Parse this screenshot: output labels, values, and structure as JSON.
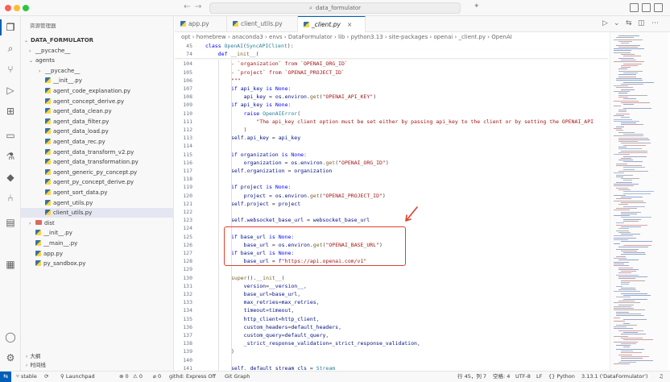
{
  "titlebar": {
    "search_text": "data_formulator"
  },
  "sidebar": {
    "title": "资源管理器",
    "tree": [
      {
        "label": "DATA_FORMULATOR",
        "depth": 0,
        "kind": "root",
        "chev": "⌄"
      },
      {
        "label": "__pycache__",
        "depth": 1,
        "kind": "folder",
        "chev": "›"
      },
      {
        "label": "agents",
        "depth": 1,
        "kind": "folder",
        "chev": "⌄"
      },
      {
        "label": "__pycache__",
        "depth": 2,
        "kind": "folder",
        "chev": "›"
      },
      {
        "label": "__init__.py",
        "depth": 2,
        "kind": "py"
      },
      {
        "label": "agent_code_explanation.py",
        "depth": 2,
        "kind": "py"
      },
      {
        "label": "agent_concept_derive.py",
        "depth": 2,
        "kind": "py"
      },
      {
        "label": "agent_data_clean.py",
        "depth": 2,
        "kind": "py"
      },
      {
        "label": "agent_data_filter.py",
        "depth": 2,
        "kind": "py"
      },
      {
        "label": "agent_data_load.py",
        "depth": 2,
        "kind": "py"
      },
      {
        "label": "agent_data_rec.py",
        "depth": 2,
        "kind": "py"
      },
      {
        "label": "agent_data_transform_v2.py",
        "depth": 2,
        "kind": "py"
      },
      {
        "label": "agent_data_transformation.py",
        "depth": 2,
        "kind": "py"
      },
      {
        "label": "agent_generic_py_concept.py",
        "depth": 2,
        "kind": "py"
      },
      {
        "label": "agent_py_concept_derive.py",
        "depth": 2,
        "kind": "py"
      },
      {
        "label": "agent_sort_data.py",
        "depth": 2,
        "kind": "py"
      },
      {
        "label": "agent_utils.py",
        "depth": 2,
        "kind": "py"
      },
      {
        "label": "client_utils.py",
        "depth": 2,
        "kind": "py",
        "selected": true
      },
      {
        "label": "dist",
        "depth": 1,
        "kind": "folder-red",
        "chev": "›"
      },
      {
        "label": "__init__.py",
        "depth": 1,
        "kind": "py"
      },
      {
        "label": "__main__.py",
        "depth": 1,
        "kind": "py"
      },
      {
        "label": "app.py",
        "depth": 1,
        "kind": "py"
      },
      {
        "label": "py_sandbox.py",
        "depth": 1,
        "kind": "py"
      }
    ],
    "outline_label": "大纲",
    "timeline_label": "时间线"
  },
  "tabs": [
    {
      "label": "app.py",
      "active": false
    },
    {
      "label": "client_utils.py",
      "active": false
    },
    {
      "label": "_client.py",
      "active": true
    }
  ],
  "breadcrumb": "opt › homebrew › anaconda3 › envs › DataFormulator › lib › python3.13 › site-packages › openai › _client.py › OpenAI",
  "sticky": [
    {
      "n": "45",
      "html": "<span class='k'>class</span> <span class='c'>OpenAI</span>(<span class='c'>SyncAPIClient</span>):"
    },
    {
      "n": "74",
      "html": "    <span class='k'>def</span> <span class='f'>__init__</span>("
    }
  ],
  "code_lines": [
    {
      "n": "104",
      "html": "- `organization` from `OPENAI_ORG_ID`",
      "cls": "s"
    },
    {
      "n": "105",
      "html": "- `project` from `OPENAI_PROJECT_ID`",
      "cls": "s"
    },
    {
      "n": "106",
      "html": "\"\"\"",
      "cls": "s"
    },
    {
      "n": "107",
      "html": "<span class='k'>if</span> <span class='v'>api_key</span> <span class='k'>is</span> <span class='k'>None</span>:"
    },
    {
      "n": "108",
      "html": "    <span class='v'>api_key</span> = <span class='v'>os</span>.<span class='v'>environ</span>.<span class='f'>get</span>(<span class='s'>\"OPENAI_API_KEY\"</span>)"
    },
    {
      "n": "109",
      "html": "<span class='k'>if</span> <span class='v'>api_key</span> <span class='k'>is</span> <span class='k'>None</span>:"
    },
    {
      "n": "110",
      "html": "    <span class='k'>raise</span> <span class='c'>OpenAIError</span>("
    },
    {
      "n": "111",
      "html": "        <span class='s'>\"The api_key client option must be set either by passing api_key to the client or by setting the OPENAI_API</span>"
    },
    {
      "n": "112",
      "html": "    )"
    },
    {
      "n": "113",
      "html": "<span class='v'>self</span>.<span class='v'>api_key</span> = <span class='v'>api_key</span>"
    },
    {
      "n": "114",
      "html": ""
    },
    {
      "n": "115",
      "html": "<span class='k'>if</span> <span class='v'>organization</span> <span class='k'>is</span> <span class='k'>None</span>:"
    },
    {
      "n": "116",
      "html": "    <span class='v'>organization</span> = <span class='v'>os</span>.<span class='v'>environ</span>.<span class='f'>get</span>(<span class='s'>\"OPENAI_ORG_ID\"</span>)"
    },
    {
      "n": "117",
      "html": "<span class='v'>self</span>.<span class='v'>organization</span> = <span class='v'>organization</span>"
    },
    {
      "n": "118",
      "html": ""
    },
    {
      "n": "119",
      "html": "<span class='k'>if</span> <span class='v'>project</span> <span class='k'>is</span> <span class='k'>None</span>:"
    },
    {
      "n": "120",
      "html": "    <span class='v'>project</span> = <span class='v'>os</span>.<span class='v'>environ</span>.<span class='f'>get</span>(<span class='s'>\"OPENAI_PROJECT_ID\"</span>)"
    },
    {
      "n": "121",
      "html": "<span class='v'>self</span>.<span class='v'>project</span> = <span class='v'>project</span>"
    },
    {
      "n": "122",
      "html": ""
    },
    {
      "n": "123",
      "html": "<span class='v'>self</span>.<span class='v'>websocket_base_url</span> = <span class='v'>websocket_base_url</span>"
    },
    {
      "n": "124",
      "html": ""
    },
    {
      "n": "125",
      "html": "<span class='k'>if</span> <span class='v'>base_url</span> <span class='k'>is</span> <span class='k'>None</span>:"
    },
    {
      "n": "126",
      "html": "    <span class='v'>base_url</span> = <span class='v'>os</span>.<span class='v'>environ</span>.<span class='f'>get</span>(<span class='s'>\"OPENAI_BASE_URL\"</span>)"
    },
    {
      "n": "127",
      "html": "<span class='k'>if</span> <span class='v'>base_url</span> <span class='k'>is</span> <span class='k'>None</span>:"
    },
    {
      "n": "128",
      "html": "    <span class='v'>base_url</span> = <span class='k'>f</span><span class='s'>\"https://api.openai.com/v1\"</span>"
    },
    {
      "n": "129",
      "html": ""
    },
    {
      "n": "130",
      "html": "<span class='f'>super</span>().<span class='f'>__init__</span>("
    },
    {
      "n": "131",
      "html": "    <span class='v'>version</span>=<span class='v'>__version__</span>,"
    },
    {
      "n": "132",
      "html": "    <span class='v'>base_url</span>=<span class='v'>base_url</span>,"
    },
    {
      "n": "133",
      "html": "    <span class='v'>max_retries</span>=<span class='v'>max_retries</span>,"
    },
    {
      "n": "134",
      "html": "    <span class='v'>timeout</span>=<span class='v'>timeout</span>,"
    },
    {
      "n": "135",
      "html": "    <span class='v'>http_client</span>=<span class='v'>http_client</span>,"
    },
    {
      "n": "136",
      "html": "    <span class='v'>custom_headers</span>=<span class='v'>default_headers</span>,"
    },
    {
      "n": "137",
      "html": "    <span class='v'>custom_query</span>=<span class='v'>default_query</span>,"
    },
    {
      "n": "138",
      "html": "    <span class='v'>_strict_response_validation</span>=<span class='v'>_strict_response_validation</span>,"
    },
    {
      "n": "139",
      "html": ")"
    },
    {
      "n": "140",
      "html": ""
    },
    {
      "n": "141",
      "html": "<span class='v'>self</span>.<span class='v'>_default_stream_cls</span> = <span class='c'>Stream</span>"
    }
  ],
  "statusbar": {
    "remote": "⇆",
    "branch": "stable",
    "launchpad": "Launchpad",
    "errors": "⊗ 0",
    "warnings": "⚠ 0",
    "ports": "⌀ 0",
    "githd": "githd: Express Off",
    "gitgraph": "Git Graph",
    "position": "行 45，列 7",
    "spaces": "空格: 4",
    "encoding": "UTF-8",
    "eol": "LF",
    "language": "Python",
    "interpreter": "3.13.1 ('DataFormulator')"
  },
  "colors": {
    "accent": "#005fb8",
    "annotation": "#e0402f"
  },
  "icons": [
    "files-icon",
    "search-icon",
    "source-control-icon",
    "run-debug-icon",
    "extensions-icon",
    "remote-explorer-icon",
    "testing-icon",
    "python-icon",
    "git-graph-icon",
    "folder-icon",
    "docker-icon",
    "account-icon",
    "settings-icon"
  ]
}
